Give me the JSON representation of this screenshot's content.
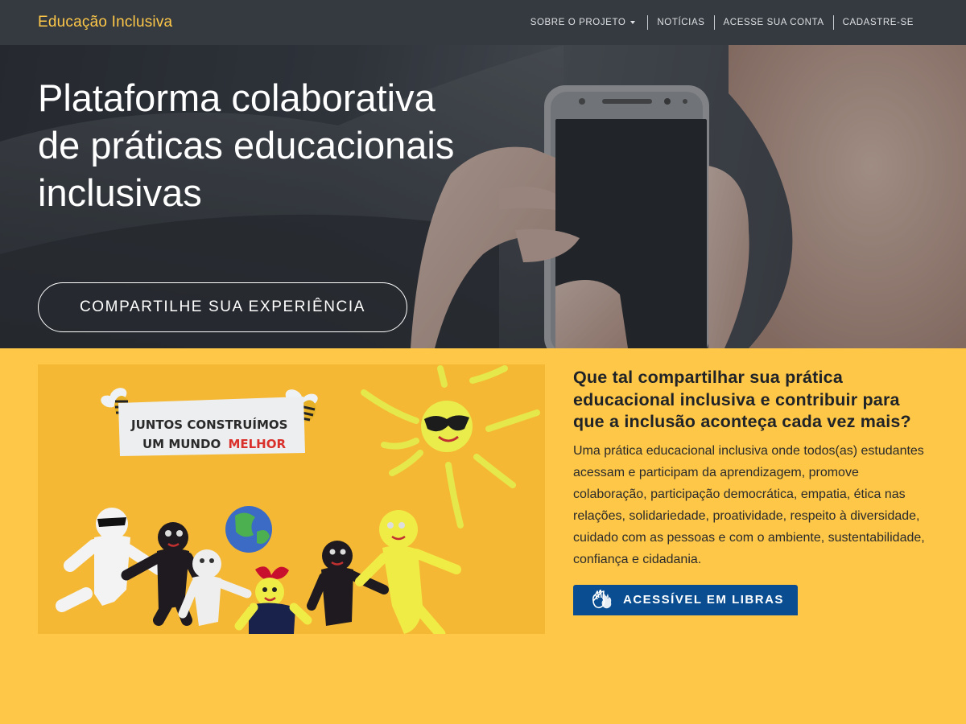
{
  "navbar": {
    "brand": "Educação Inclusiva",
    "items": [
      {
        "label": "SOBRE O PROJETO",
        "dropdown": true
      },
      {
        "label": "NOTÍCIAS"
      },
      {
        "label": "ACESSE SUA CONTA"
      },
      {
        "label": "CADASTRE-SE"
      }
    ]
  },
  "hero": {
    "title": "Plataforma colaborativa de práticas educacionais inclusivas",
    "cta_label": "COMPARTILHE SUA EXPERIÊNCIA"
  },
  "illustration": {
    "sign_line1": "JUNTOS CONSTRUÍMOS",
    "sign_line2_a": "UM MUNDO",
    "sign_line2_b": "MELHOR"
  },
  "content": {
    "heading": "Que tal compartilhar sua prática educacional inclusiva e contribuir para que a inclusão aconteça cada vez mais?",
    "body": "Uma prática educacional inclusiva onde todos(as) estudantes acessam e participam da aprendizagem, promove colaboração, participação democrática, empatia, ética nas relações, solidariedade, proatividade, respeito à diversidade, cuidado com as pessoas e com o ambiente, sustentabilidade, confiança e cidadania.",
    "libras_label": "ACESSÍVEL EM LIBRAS",
    "libras_icon": "sign-language-hands-icon"
  },
  "colors": {
    "navbar_bg": "#343a40",
    "brand": "#fec748",
    "section_bg": "#fec748",
    "libras_button": "#0a4d91",
    "sign_accent": "#d9302b"
  }
}
